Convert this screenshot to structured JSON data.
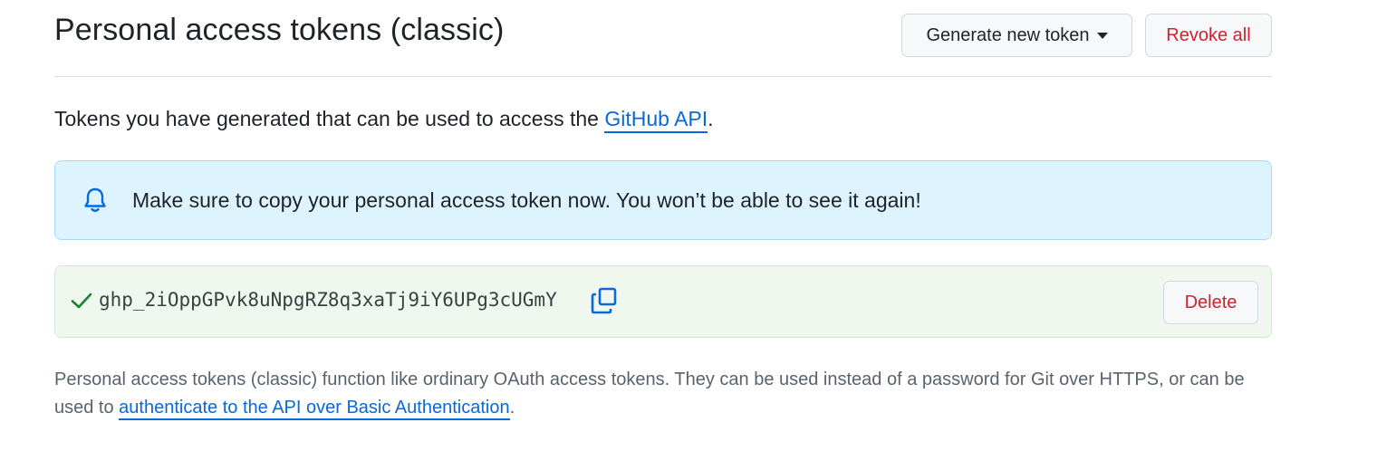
{
  "header": {
    "title": "Personal access tokens (classic)",
    "generate_label": "Generate new token",
    "revoke_label": "Revoke all"
  },
  "intro": {
    "text": "Tokens you have generated that can be used to access the ",
    "link": "GitHub API",
    "suffix": "."
  },
  "flash": {
    "icon": "bell-icon",
    "message": "Make sure to copy your personal access token now. You won’t be able to see it again!"
  },
  "token": {
    "status_icon": "check-icon",
    "value": "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",
    "copy_icon": "copy-icon",
    "delete_label": "Delete"
  },
  "note": {
    "text": "Personal access tokens (classic) function like ordinary OAuth access tokens. They can be used instead of a password for Git over HTTPS, or can be used to ",
    "link": "authenticate to the API over Basic Authentication",
    "suffix": "."
  },
  "colors": {
    "link": "#0969da",
    "danger": "#cf222e",
    "success": "#1a7f37",
    "flash_bg": "#ddf4ff",
    "token_bg": "#f0f7ee"
  }
}
